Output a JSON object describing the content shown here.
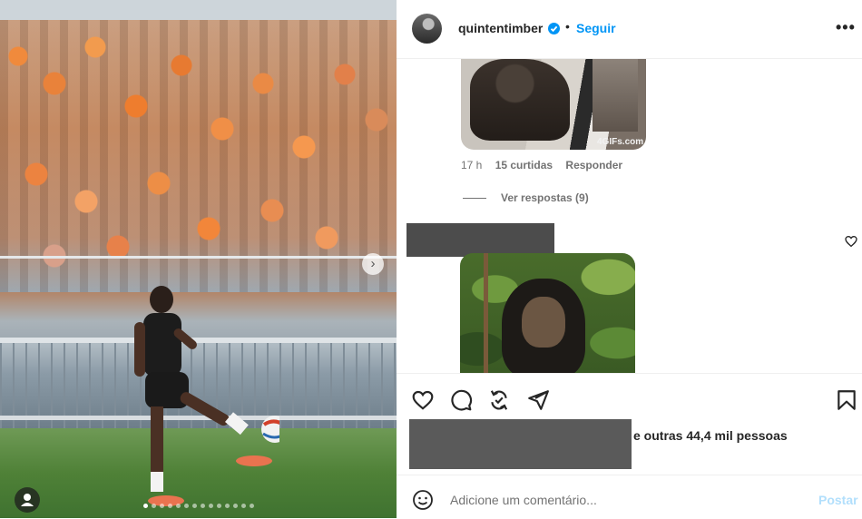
{
  "post": {
    "username": "quintentimber",
    "separator": "•",
    "follow_label": "Seguir",
    "more_label": "•••"
  },
  "carousel": {
    "next_label": "›",
    "slide_count": 14,
    "active_slide": 1
  },
  "comments": [
    {
      "gif_watermark": "4GIFs.com",
      "time": "17 h",
      "likes": "15 curtidas",
      "reply_label": "Responder",
      "view_replies": "Ver respostas (9)"
    }
  ],
  "likes_text": "e outras 44,4 mil pessoas",
  "comment_box": {
    "placeholder": "Adicione um comentário...",
    "post_label": "Postar"
  },
  "colors": {
    "accent": "#0095f6",
    "post_disabled": "#b2dffc",
    "secondary_text": "#737373"
  },
  "icons": [
    "verified-icon",
    "more-icon",
    "heart-icon",
    "comment-icon",
    "share-icon",
    "send-icon",
    "bookmark-icon",
    "emoji-icon",
    "user-tag-icon"
  ]
}
